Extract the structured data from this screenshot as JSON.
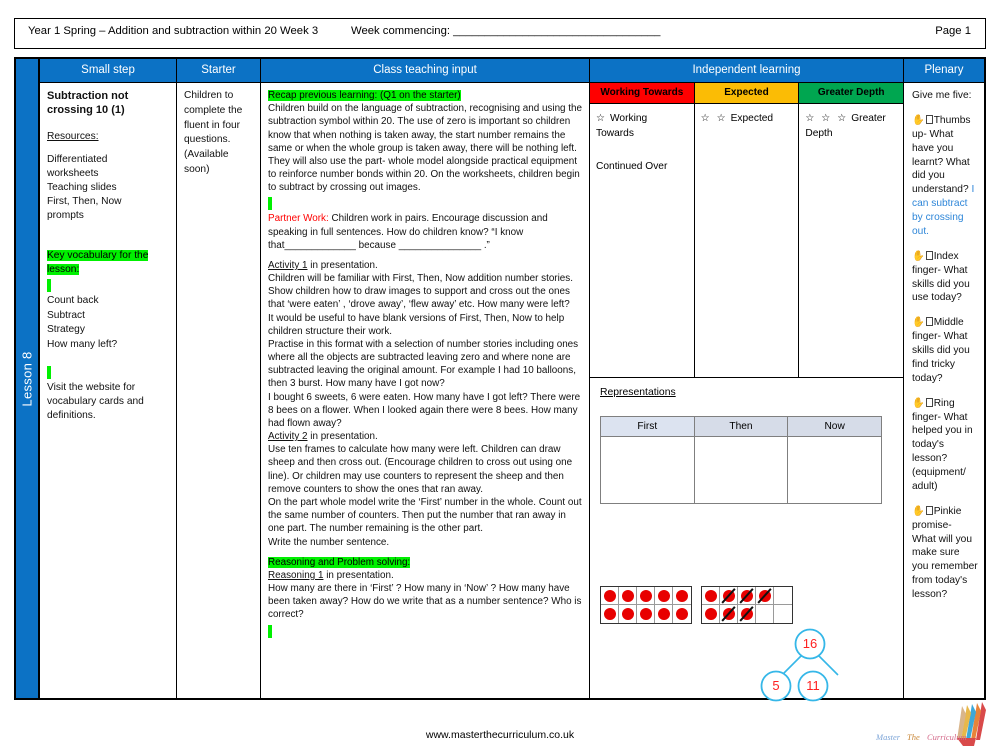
{
  "header": {
    "title": "Year 1 Spring – Addition and subtraction within 20 Week 3",
    "week_commencing": "Week commencing: _________________________________",
    "page": "Page 1"
  },
  "spine": {
    "label": "Lesson 8"
  },
  "columns": {
    "small_step": "Small step",
    "starter": "Starter",
    "teaching": "Class teaching input",
    "independent": "Independent learning",
    "plenary": "Plenary"
  },
  "small_step": {
    "title": "Subtraction not crossing 10 (1)",
    "resources_label": "Resources:",
    "resources": "Differentiated worksheets Teaching slides First, Then, Now prompts",
    "vocab_heading": "Key vocabulary for the lesson:",
    "vocab_words": "Count back\nSubtract\nStrategy\nHow many left?",
    "vocab_note": "Visit the website for vocabulary cards and definitions."
  },
  "starter": {
    "text": "Children to complete the fluent in four questions. (Available soon)"
  },
  "teaching": {
    "recap_heading": "Recap previous learning: (Q1 on the starter)",
    "recap_body": "Children build on the language of subtraction, recognising and using the subtraction symbol within 20.  The use of zero is important so children know that when nothing is taken away, the start number remains the same or when the whole group is taken away, there will be nothing left. They will also use the part- whole model alongside practical equipment to reinforce number bonds within 20. On the worksheets, children begin to subtract by crossing out images.",
    "partner_label": "Partner Work:",
    "partner_body": " Children work in pairs. Encourage discussion and speaking in full sentences. How do children know?  “I know that_____________ because _______________ .”",
    "activity1_label": "Activity 1",
    "activity1_suffix": " in presentation.",
    "activity1_body": "Children will be familiar with First, Then, Now  addition number stories. Show children how to draw images to support and cross out the ones that ‘were eaten’ , ‘drove away’, ‘flew away’ etc. How many were left?\nIt would be useful to have blank versions of First, Then, Now to help children structure their work.\nPractise in this format with a selection of number stories including ones where all the objects are subtracted leaving zero and where none are subtracted leaving the original amount. For example I had 10 balloons, then 3 burst. How many have I got now?\nI bought 6 sweets, 6 were eaten. How many have I got left? There were 8 bees on a flower. When I looked again there were 8 bees. How many had flown away?",
    "activity2_label": "Activity 2",
    "activity2_suffix": " in presentation.",
    "activity2_body": "Use ten frames to calculate how many were left. Children can draw sheep and then cross out. (Encourage children to cross out using one line). Or children may use counters to represent the sheep and then remove counters to show the ones that ran away.\nOn the part whole model write the ‘First’ number in the whole. Count out the same number of counters. Then put the number that ran away in one part. The number remaining is the other part.\nWrite the number sentence.",
    "reasoning_heading": "Reasoning and Problem solving:",
    "reasoning_label": "Reasoning 1",
    "reasoning_suffix": " in presentation.",
    "reasoning_body": "How many are there  in ‘First’ ? How many in ‘Now’ ? How many have been taken away? How do we write that as a number sentence? Who is correct?"
  },
  "independent": {
    "bands": [
      {
        "label": "Working Towards",
        "color": "#FF0000",
        "stars": "☆",
        "text": "Working Towards",
        "continued": "Continued Over"
      },
      {
        "label": "Expected",
        "color": "#FBBC05",
        "stars": "☆ ☆",
        "text": "Expected",
        "continued": ""
      },
      {
        "label": "Greater Depth",
        "color": "#00A650",
        "stars": "☆ ☆ ☆",
        "text": "Greater Depth",
        "continued": ""
      }
    ],
    "representations_title": "Representations",
    "ftn_headers": [
      "First",
      "Then",
      "Now"
    ],
    "ten_frames": [
      {
        "name": "full-ten-frame",
        "cells": [
          {
            "filled": true,
            "crossed": false
          },
          {
            "filled": true,
            "crossed": false
          },
          {
            "filled": true,
            "crossed": false
          },
          {
            "filled": true,
            "crossed": false
          },
          {
            "filled": true,
            "crossed": false
          },
          {
            "filled": true,
            "crossed": false
          },
          {
            "filled": true,
            "crossed": false
          },
          {
            "filled": true,
            "crossed": false
          },
          {
            "filled": true,
            "crossed": false
          },
          {
            "filled": true,
            "crossed": false
          }
        ]
      },
      {
        "name": "crossed-ten-frame",
        "cells": [
          {
            "filled": true,
            "crossed": false
          },
          {
            "filled": true,
            "crossed": true
          },
          {
            "filled": true,
            "crossed": true
          },
          {
            "filled": true,
            "crossed": true
          },
          {
            "filled": false,
            "crossed": false
          },
          {
            "filled": true,
            "crossed": false
          },
          {
            "filled": true,
            "crossed": true
          },
          {
            "filled": true,
            "crossed": true
          },
          {
            "filled": false,
            "crossed": false
          },
          {
            "filled": false,
            "crossed": false
          }
        ]
      }
    ],
    "part_whole": {
      "whole": "16",
      "part_left": "5",
      "part_right": "11",
      "circle_color": "#35B7E8",
      "number_color": "#FF2020"
    }
  },
  "plenary": {
    "items": [
      {
        "icon": "hand-icon",
        "text": "Give me five:"
      },
      {
        "icon": "hand-icon",
        "text": "Thumbs up- What have you learnt? What did you understand?",
        "answer": "I can subtract by crossing out."
      },
      {
        "icon": "hand-icon",
        "text": "Index finger- What skills did you use today?"
      },
      {
        "icon": "hand-icon",
        "text": "Middle finger- What skills did you find tricky today?"
      },
      {
        "icon": "hand-icon",
        "text": "Ring finger- What helped you in today's lesson? (equipment/ adult)"
      },
      {
        "icon": "hand-icon",
        "text": "Pinkie promise- What will you make sure you remember from today's lesson?"
      }
    ]
  },
  "footer": {
    "url": "www.masterthecurriculum.co.uk",
    "logo_text": "Master The Curriculum"
  }
}
